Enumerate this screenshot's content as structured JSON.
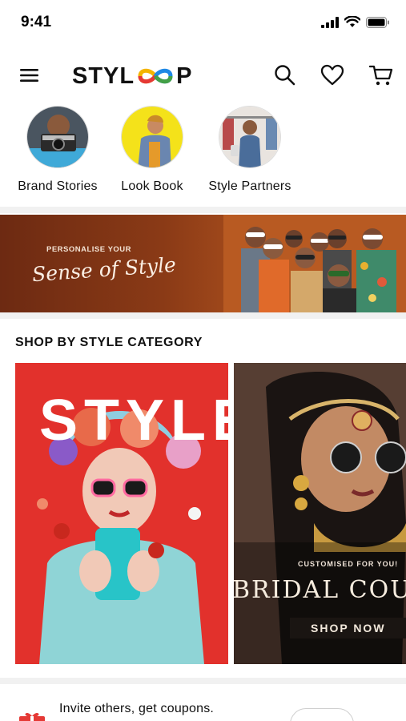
{
  "status_bar": {
    "time": "9:41"
  },
  "header": {
    "logo_prefix": "STYL",
    "logo_suffix": "P",
    "icons": [
      "menu-icon",
      "search-icon",
      "heart-icon",
      "cart-icon"
    ]
  },
  "stories": [
    {
      "label": "Brand Stories"
    },
    {
      "label": "Look Book"
    },
    {
      "label": "Style Partners"
    }
  ],
  "promo": {
    "small_text": "PERSONALISE YOUR",
    "script_text": "Sense of Style"
  },
  "section": {
    "title": "SHOP BY STYLE CATEGORY"
  },
  "categories": [
    {
      "headline": "STYLE"
    },
    {
      "subtitle": "CUSTOMISED FOR YOU!",
      "headline": "BRIDAL COUT",
      "cta": "SHOP NOW"
    }
  ],
  "invite": {
    "text": "Invite others, get coupons."
  },
  "colors": {
    "accent_red": "#e2312c",
    "banner_brown": "#8a3a16",
    "logo_gradient": [
      "#f4b400",
      "#e53935",
      "#1e88e5",
      "#43a047"
    ]
  }
}
